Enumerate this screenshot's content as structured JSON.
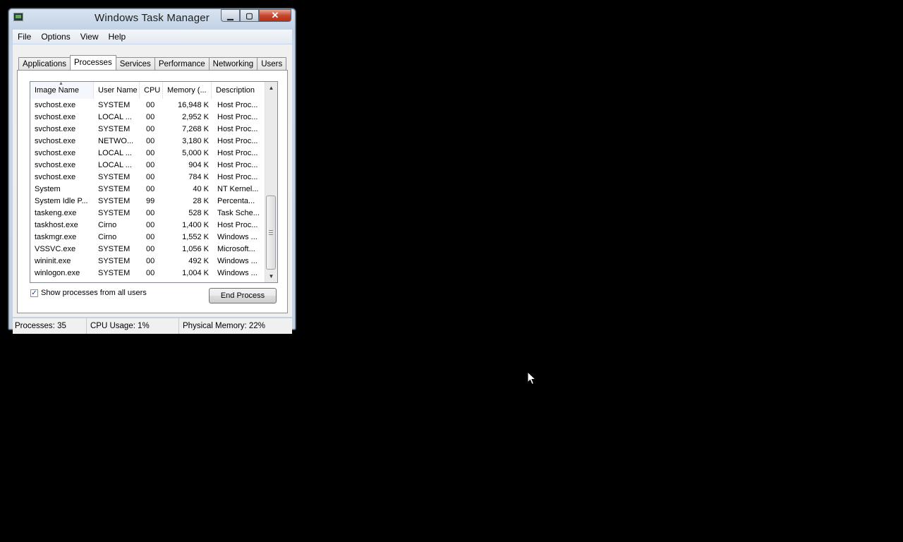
{
  "window": {
    "title": "Windows Task Manager"
  },
  "titlebar_buttons": {
    "minimize": "▁",
    "maximize": "▢",
    "close": "✕"
  },
  "menu": [
    "File",
    "Options",
    "View",
    "Help"
  ],
  "tabs": [
    "Applications",
    "Processes",
    "Services",
    "Performance",
    "Networking",
    "Users"
  ],
  "active_tab": "Processes",
  "columns": {
    "image_name": "Image Name",
    "user_name": "User Name",
    "cpu": "CPU",
    "memory": "Memory (...",
    "description": "Description"
  },
  "processes": [
    {
      "image": "svchost.exe",
      "user": "SYSTEM",
      "cpu": "00",
      "memory": "16,948 K",
      "desc": "Host Proc..."
    },
    {
      "image": "svchost.exe",
      "user": "LOCAL ...",
      "cpu": "00",
      "memory": "2,952 K",
      "desc": "Host Proc..."
    },
    {
      "image": "svchost.exe",
      "user": "SYSTEM",
      "cpu": "00",
      "memory": "7,268 K",
      "desc": "Host Proc..."
    },
    {
      "image": "svchost.exe",
      "user": "NETWO...",
      "cpu": "00",
      "memory": "3,180 K",
      "desc": "Host Proc..."
    },
    {
      "image": "svchost.exe",
      "user": "LOCAL ...",
      "cpu": "00",
      "memory": "5,000 K",
      "desc": "Host Proc..."
    },
    {
      "image": "svchost.exe",
      "user": "LOCAL ...",
      "cpu": "00",
      "memory": "904 K",
      "desc": "Host Proc..."
    },
    {
      "image": "svchost.exe",
      "user": "SYSTEM",
      "cpu": "00",
      "memory": "784 K",
      "desc": "Host Proc..."
    },
    {
      "image": "System",
      "user": "SYSTEM",
      "cpu": "00",
      "memory": "40 K",
      "desc": "NT Kernel..."
    },
    {
      "image": "System Idle P...",
      "user": "SYSTEM",
      "cpu": "99",
      "memory": "28 K",
      "desc": "Percenta..."
    },
    {
      "image": "taskeng.exe",
      "user": "SYSTEM",
      "cpu": "00",
      "memory": "528 K",
      "desc": "Task Sche..."
    },
    {
      "image": "taskhost.exe",
      "user": "Cirno",
      "cpu": "00",
      "memory": "1,400 K",
      "desc": "Host Proc..."
    },
    {
      "image": "taskmgr.exe",
      "user": "Cirno",
      "cpu": "00",
      "memory": "1,552 K",
      "desc": "Windows ..."
    },
    {
      "image": "VSSVC.exe",
      "user": "SYSTEM",
      "cpu": "00",
      "memory": "1,056 K",
      "desc": "Microsoft..."
    },
    {
      "image": "wininit.exe",
      "user": "SYSTEM",
      "cpu": "00",
      "memory": "492 K",
      "desc": "Windows ..."
    },
    {
      "image": "winlogon.exe",
      "user": "SYSTEM",
      "cpu": "00",
      "memory": "1,004 K",
      "desc": "Windows ..."
    }
  ],
  "show_all_users": {
    "label": "Show processes from all users",
    "checked": true,
    "mark": "✓"
  },
  "end_process_label": "End Process",
  "status": {
    "processes": "Processes: 35",
    "cpu_usage": "CPU Usage: 1%",
    "physical_memory": "Physical Memory: 22%"
  },
  "icons": {
    "app": "task-manager-icon",
    "sort": "sort-ascending-icon",
    "scroll_up": "▲",
    "scroll_down": "▼",
    "cursor": "mouse-pointer-icon"
  }
}
